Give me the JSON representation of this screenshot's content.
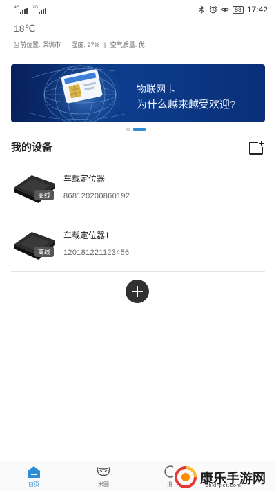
{
  "status_bar": {
    "network1": "4G",
    "network2": "2G",
    "battery": "88",
    "time": "17:42"
  },
  "weather": {
    "temperature": "18℃",
    "location_label": "当前位置: 深圳市",
    "humidity_label": "湿度: 97%",
    "air_label": "空气质量: 优",
    "separator": "|"
  },
  "banner": {
    "line1": "物联网卡",
    "line2": "为什么越来越受欢迎?"
  },
  "devices_section": {
    "title": "我的设备"
  },
  "devices": [
    {
      "name": "车载定位器",
      "imei": "868120200860192",
      "status": "离线"
    },
    {
      "name": "车载定位器1",
      "imei": "120181221123456",
      "status": "离线"
    }
  ],
  "bottom_nav": {
    "items": [
      {
        "label": "首页",
        "icon": "home-icon",
        "active": true
      },
      {
        "label": "米圈",
        "icon": "mask-icon",
        "active": false
      },
      {
        "label": "消",
        "icon": "message-icon",
        "active": false
      }
    ]
  },
  "watermark": {
    "title": "康乐手游网",
    "subtitle": "chkl-pet.com"
  },
  "colors": {
    "accent": "#2d8cd6",
    "banner_bg": "#0c3d8c"
  }
}
